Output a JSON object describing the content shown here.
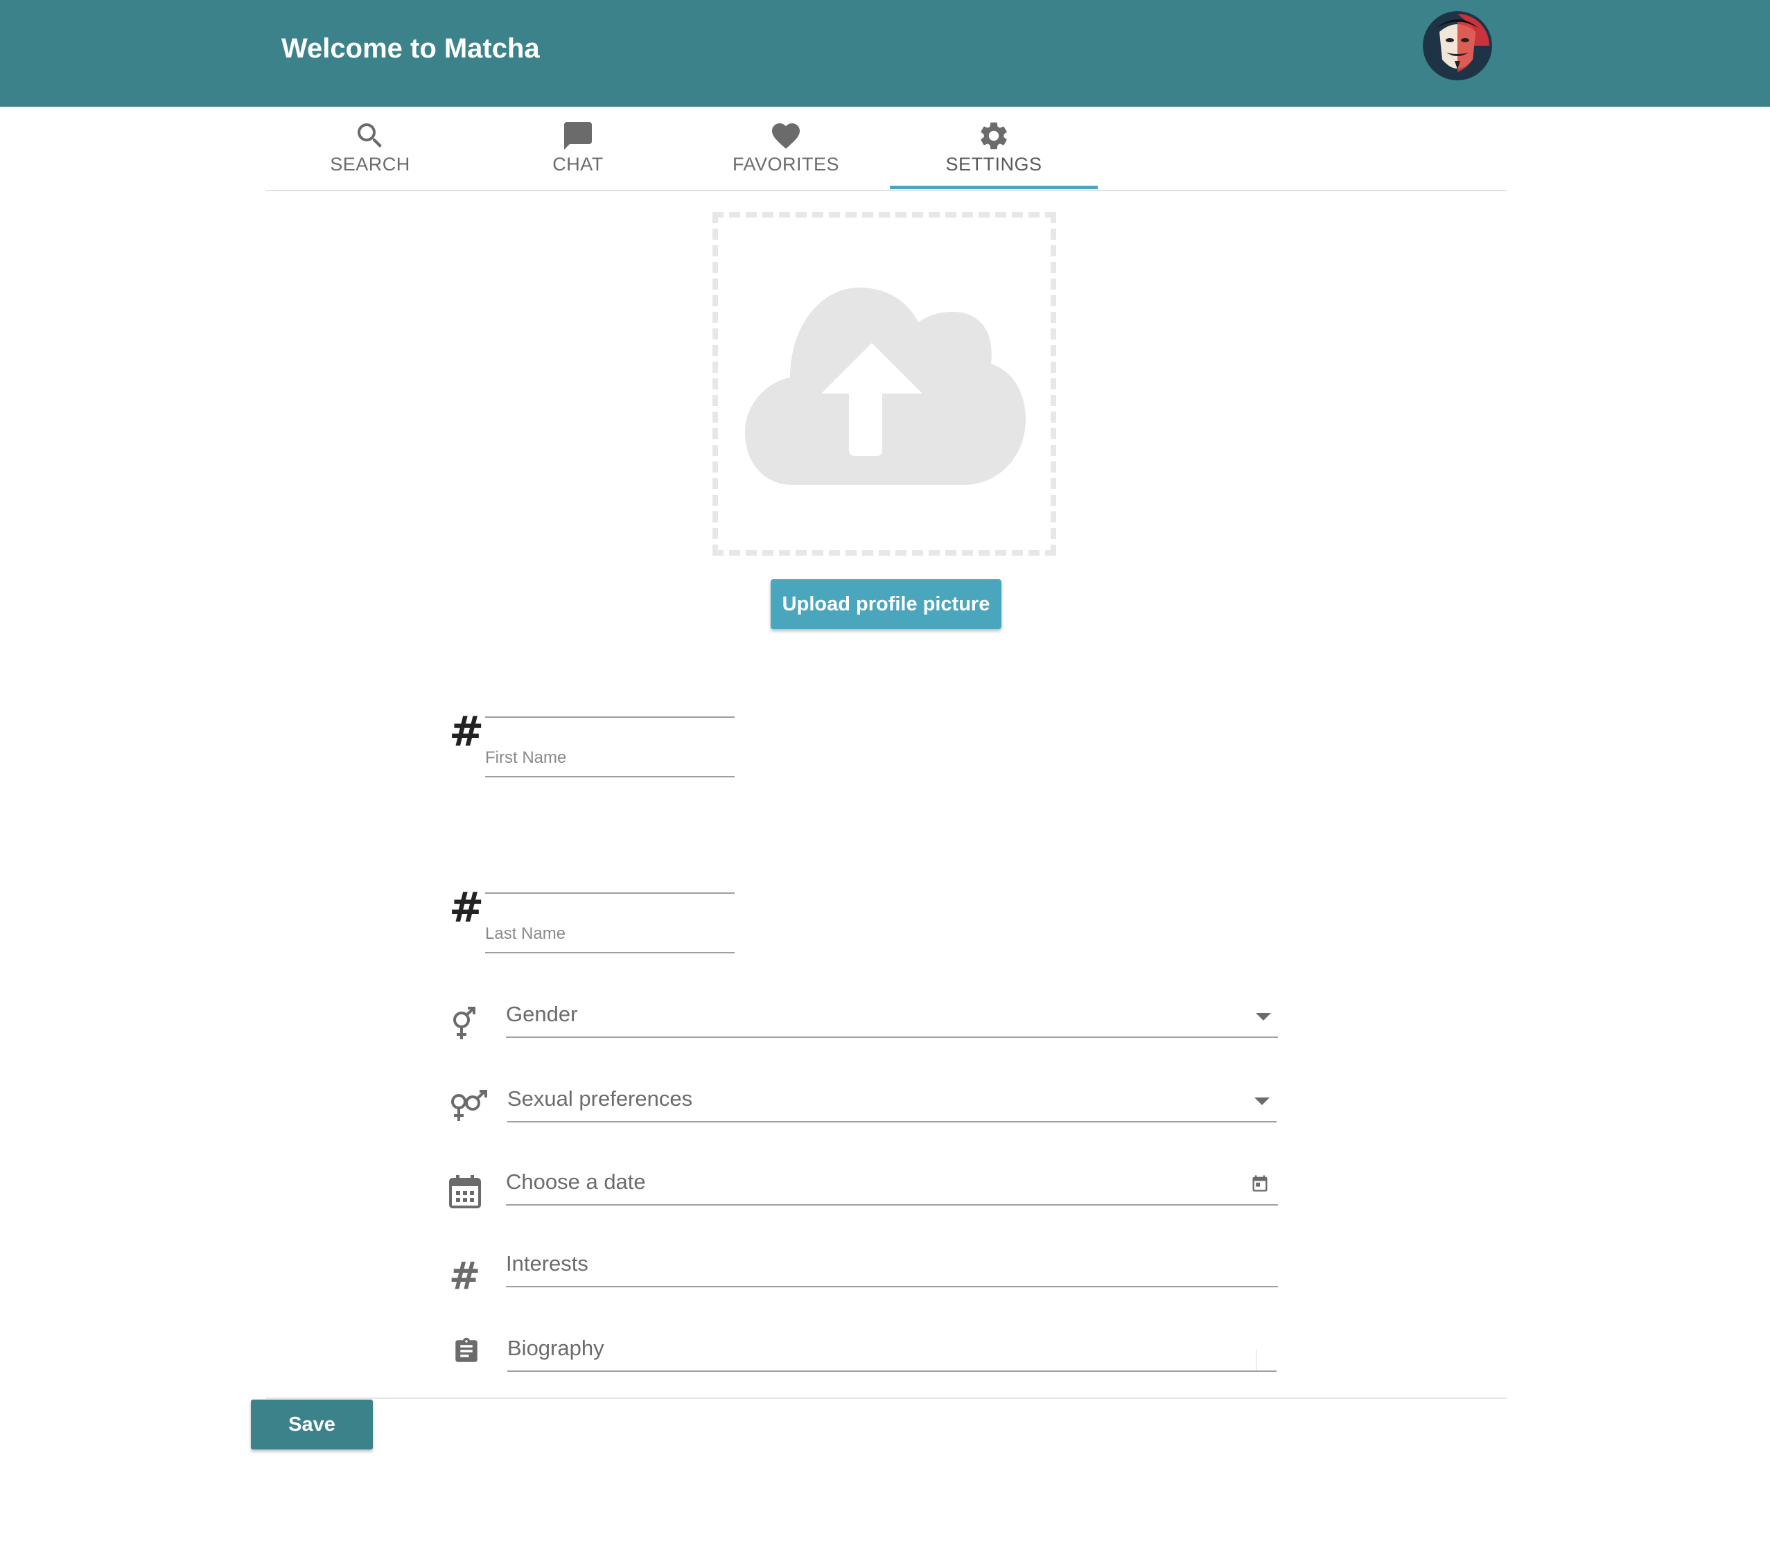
{
  "colors": {
    "header_bg": "#3b828b",
    "accent": "#4aa6bd",
    "save_bg": "#3b828b",
    "icon_gray": "#6b6b6b"
  },
  "header": {
    "title": "Welcome to Matcha"
  },
  "tabs": [
    {
      "label": "SEARCH",
      "icon": "search-icon"
    },
    {
      "label": "CHAT",
      "icon": "chat-icon"
    },
    {
      "label": "FAVORITES",
      "icon": "heart-icon"
    },
    {
      "label": "SETTINGS",
      "icon": "gear-icon",
      "active": true
    }
  ],
  "upload": {
    "button_label": "Upload profile picture",
    "icon": "cloud-upload-icon"
  },
  "form": {
    "first_name": {
      "label": "First Name",
      "value": ""
    },
    "last_name": {
      "label": "Last Name",
      "value": ""
    },
    "gender": {
      "placeholder": "Gender"
    },
    "sexual_preferences": {
      "placeholder": "Sexual preferences"
    },
    "birthdate": {
      "placeholder": "Choose a date"
    },
    "interests": {
      "placeholder": "Interests"
    },
    "biography": {
      "placeholder": "Biography"
    }
  },
  "save_label": "Save"
}
